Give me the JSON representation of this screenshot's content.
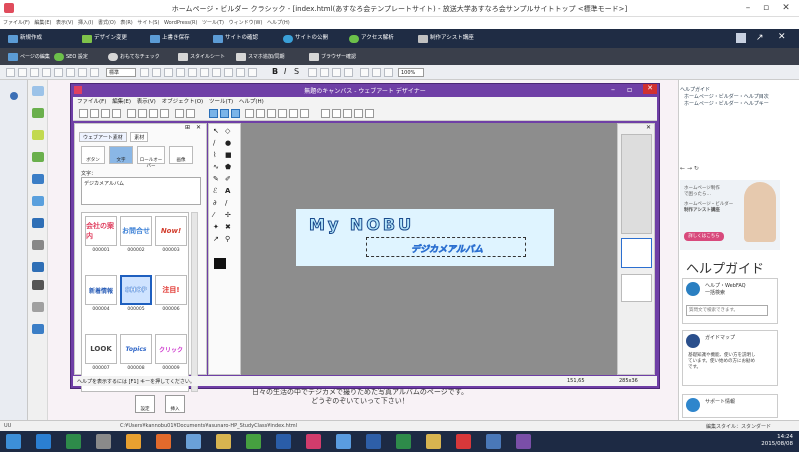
{
  "app": {
    "title": "ホームページ・ビルダー クラシック - [index.html(あすなろ会テンプレートサイト) - 放送大学あすなろ会サンプルサイトトップ <標準モード>]",
    "menu": [
      "ファイル(F)",
      "編集(E)",
      "表示(V)",
      "挿入(I)",
      "書式(O)",
      "表(R)",
      "サイト(S)",
      "WordPress(R)",
      "ツール(T)",
      "ウィンドウ(W)",
      "ヘルプ(H)"
    ],
    "ribbon": [
      "新規作成",
      "デザイン変更",
      "上書き保存",
      "サイトの確認",
      "サイトの公開",
      "アクセス解析",
      "制作アシスト講座"
    ],
    "toolbar2": [
      "ページの編集",
      "SEO 設定",
      "おもてなチェック",
      "スタイルシート",
      "スマホ追加/同期",
      "ブラウザー確認"
    ],
    "font_style": "標準",
    "zoom": "100%",
    "edit_text_line1": "日々の生活の中でデジカメで撮りためた写真アルバムのページです。",
    "edit_text_line2": "どうぞのぞいていって下さい！",
    "status_path": "C:¥Users¥kannobu01¥Documents¥asunaro-HP_StudyClass¥index.html",
    "status_left": "UU",
    "status_right": "編集スタイル：スタンダード",
    "clock_time": "14:24",
    "clock_date": "2015/08/08"
  },
  "designer": {
    "title": "無題のキャンバス - ウェブアート デザイナー",
    "menu": [
      "ファイル(F)",
      "編集(E)",
      "表示(V)",
      "オブジェクト(O)",
      "ツール(T)",
      "ヘルプ(H)"
    ],
    "tabs": [
      "ウェブアート素材",
      "素材"
    ],
    "categories": [
      "ボタン",
      "文字",
      "ロールオーバー",
      "画像"
    ],
    "text_label": "文字：",
    "text_value": "デジカメアルバム",
    "materials": [
      {
        "id": "000001",
        "label": "会社の案内",
        "color": "#e04060"
      },
      {
        "id": "000002",
        "label": "お問合せ",
        "color": "#3a7fd6"
      },
      {
        "id": "000003",
        "label": "Now!",
        "color": "#d23c2c"
      },
      {
        "id": "000004",
        "label": "新着情報",
        "color": "#2c5fb8"
      },
      {
        "id": "000005",
        "label": "SHOP",
        "color": "#ffffff"
      },
      {
        "id": "000006",
        "label": "注目!",
        "color": "#e0302a"
      },
      {
        "id": "000007",
        "label": "LOOK",
        "color": "#444444"
      },
      {
        "id": "000008",
        "label": "Topics",
        "color": "#2f66c8"
      },
      {
        "id": "000009",
        "label": "クリック",
        "color": "#cc33cc"
      }
    ],
    "btn_settings": "設定",
    "btn_insert": "挿入",
    "logo_text": "My NOBU",
    "selected_text": "デジカメアルバム",
    "status_help": "ヘルプを表示するには [F1] キーを押してください。",
    "status_coords": "151,65",
    "status_size": "285x36"
  },
  "help": {
    "tree": [
      "ヘルプガイド",
      "ホームページ・ビルダー・ヘルプ目次",
      "ホームページ・ビルダー・ヘルプキー"
    ],
    "ad_line1": "ホームページ制作",
    "ad_line2": "で困ったら…",
    "ad_line3": "ホームページ・ビルダー",
    "ad_line4": "制作アシスト講座",
    "ad_button": "詳しくはこちら",
    "guide_title": "ヘルプガイド",
    "faq_title": "ヘルプ・WebFAQ",
    "faq_sub": "一括検索",
    "faq_input": "質問文で検索できます。",
    "map_title": "ガイドマップ",
    "map_desc": "基礎知識や機能、使い方を説明しています。使い始めの方にお勧めです。",
    "support_title": "サポート情報"
  }
}
